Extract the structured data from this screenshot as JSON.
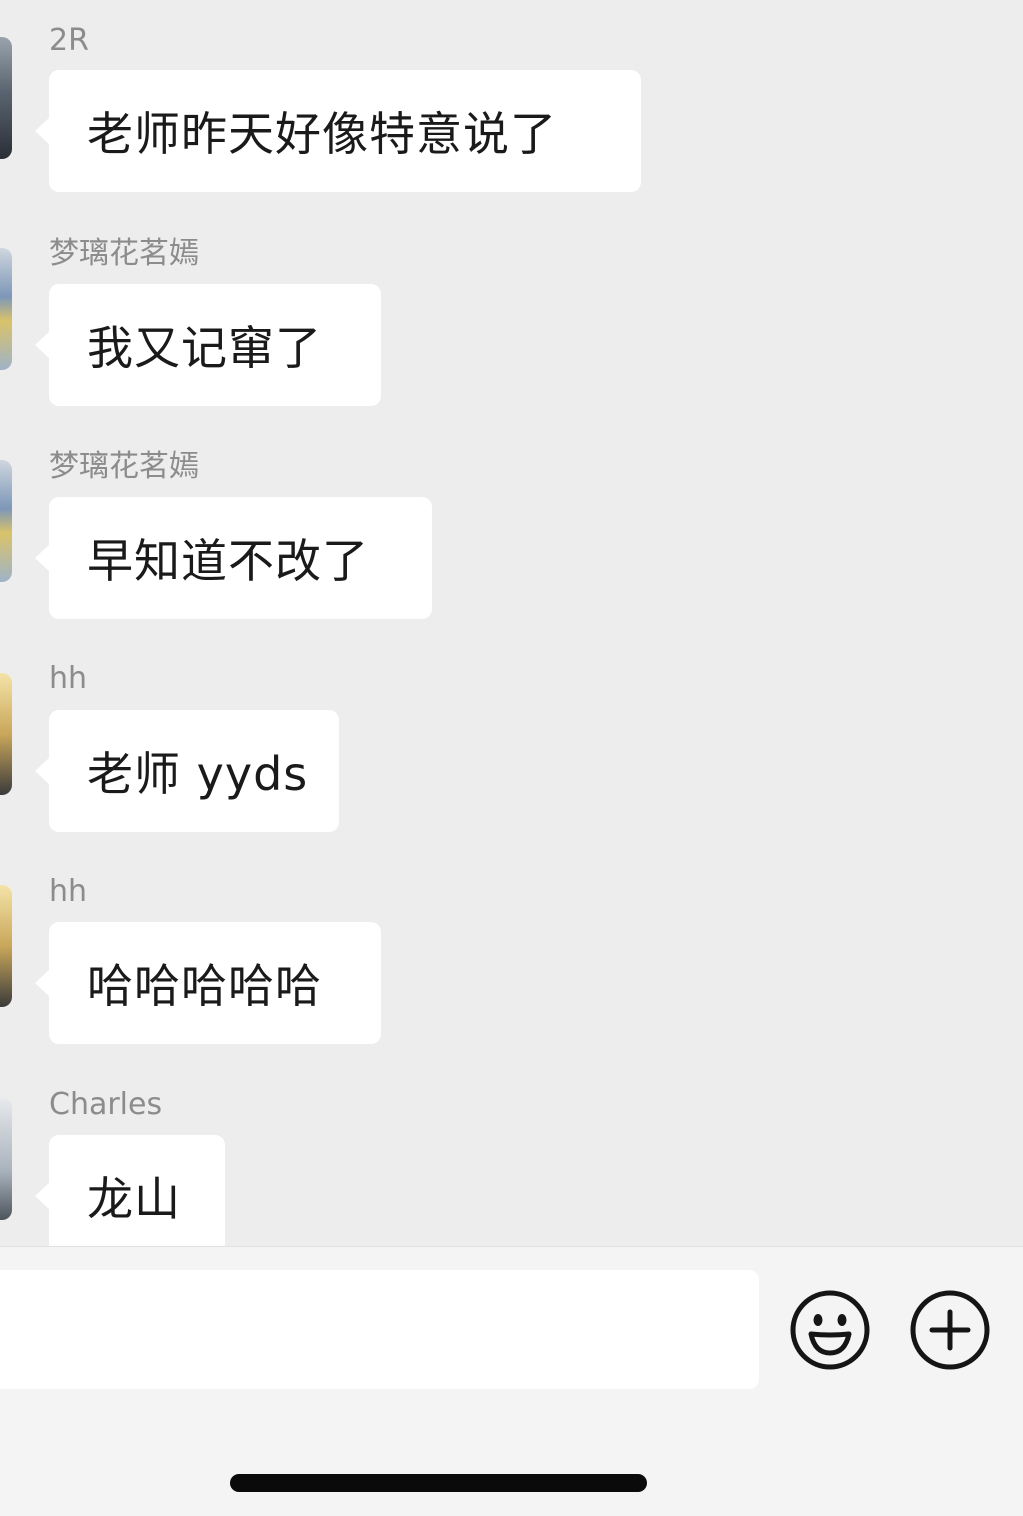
{
  "messages": [
    {
      "sender": "2R",
      "text": "老师昨天好像特意说了"
    },
    {
      "sender": "梦璃花茗嫣",
      "text": "我又记窜了"
    },
    {
      "sender": "梦璃花茗嫣",
      "text": "早知道不改了"
    },
    {
      "sender": "hh",
      "text": "老师 yyds"
    },
    {
      "sender": "hh",
      "text": "哈哈哈哈哈"
    },
    {
      "sender": "Charles",
      "text": "龙山"
    }
  ],
  "input": {
    "value": "",
    "placeholder": ""
  },
  "icons": {
    "emoji": "smiley-face-icon",
    "more": "plus-circle-icon"
  }
}
